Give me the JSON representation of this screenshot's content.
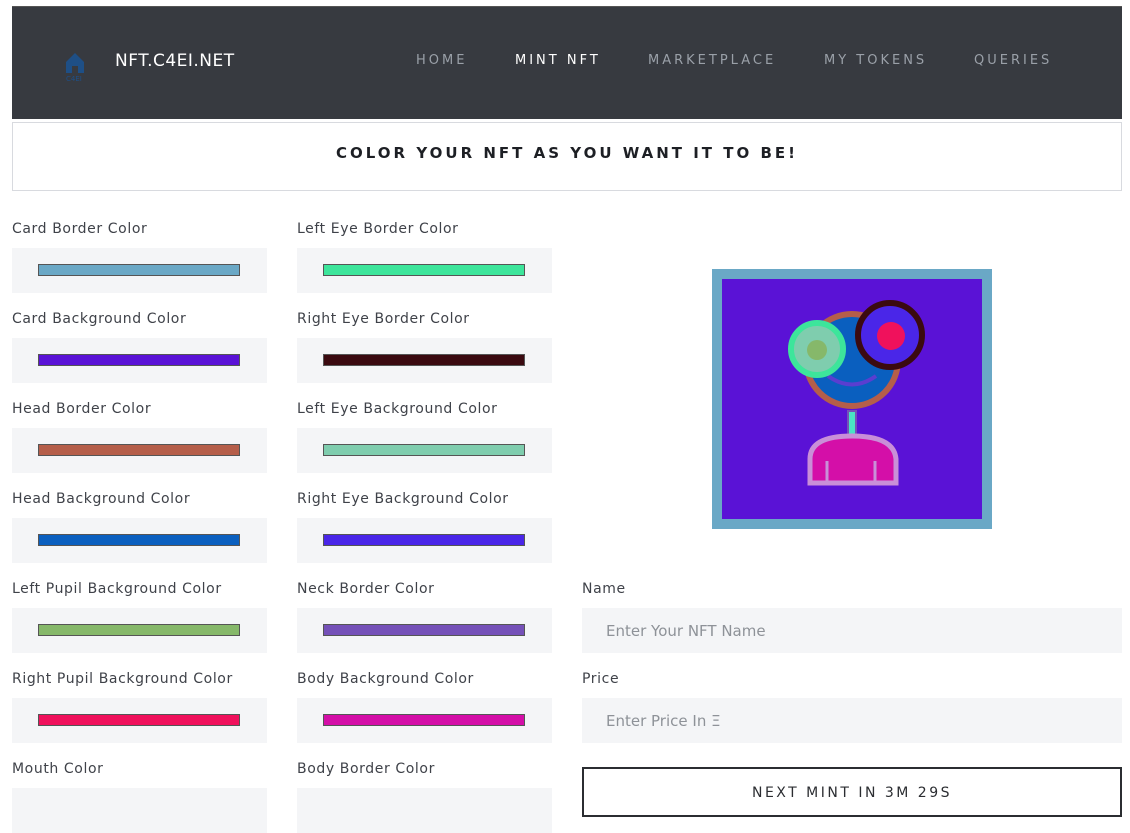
{
  "header": {
    "logo_icon": "c4ei-house-logo",
    "brand": "NFT.C4EI.NET",
    "nav": [
      "HOME",
      "MINT NFT",
      "MARKETPLACE",
      "MY TOKENS",
      "QUERIES"
    ],
    "active_nav": "MINT NFT"
  },
  "banner": {
    "title": "COLOR YOUR NFT AS YOU WANT IT TO BE!"
  },
  "color_fields": {
    "card_border": {
      "label": "Card Border Color",
      "value": "#6aa8c6"
    },
    "left_eye_border": {
      "label": "Left Eye Border Color",
      "value": "#3de59b"
    },
    "card_background": {
      "label": "Card Background Color",
      "value": "#5a12d6"
    },
    "right_eye_border": {
      "label": "Right Eye Border Color",
      "value": "#3b0a10"
    },
    "head_border": {
      "label": "Head Border Color",
      "value": "#b55e4a"
    },
    "left_eye_background": {
      "label": "Left Eye Background Color",
      "value": "#7fcdae"
    },
    "head_background": {
      "label": "Head Background Color",
      "value": "#0a5fbf"
    },
    "right_eye_background": {
      "label": "Right Eye Background Color",
      "value": "#4a26e8"
    },
    "left_pupil_background": {
      "label": "Left Pupil Background Color",
      "value": "#86b86a"
    },
    "neck_border": {
      "label": "Neck Border Color",
      "value": "#7551b8"
    },
    "right_pupil_background": {
      "label": "Right Pupil Background Color",
      "value": "#f0115c"
    },
    "body_background": {
      "label": "Body Background Color",
      "value": "#d40fa8"
    },
    "mouth": {
      "label": "Mouth Color"
    },
    "body_border": {
      "label": "Body Border Color"
    }
  },
  "form": {
    "name_label": "Name",
    "name_placeholder": "Enter Your NFT Name",
    "price_label": "Price",
    "price_placeholder": "Enter Price In Ξ",
    "mint_button": "NEXT MINT IN 3M 29S"
  },
  "preview_colors": {
    "neck": "#4ae3c4",
    "body_border": "#c98fd8",
    "mouth": "#5a3ed0"
  }
}
